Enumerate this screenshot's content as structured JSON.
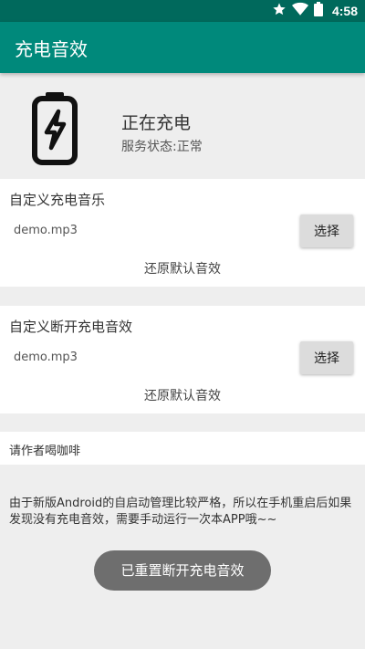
{
  "status_bar": {
    "time": "4:58",
    "icons": [
      "star-icon",
      "wifi-icon",
      "battery-icon"
    ]
  },
  "app_bar": {
    "title": "充电音效"
  },
  "charging_status": {
    "icon": "charging-battery-icon",
    "title": "正在充电",
    "service_status": "服务状态:正常"
  },
  "charge_sound": {
    "title": "自定义充电音乐",
    "file": "demo.mp3",
    "select_label": "选择",
    "restore_label": "还原默认音效"
  },
  "disconnect_sound": {
    "title": "自定义断开充电音效",
    "file": "demo.mp3",
    "select_label": "选择",
    "restore_label": "还原默认音效"
  },
  "coffee": {
    "label": "请作者喝咖啡"
  },
  "notice": {
    "text": "由于新版Android的自启动管理比较严格，所以在手机重启后如果发现没有充电音效，需要手动运行一次本APP哦~~"
  },
  "toast": {
    "text": "已重置断开充电音效"
  },
  "colors": {
    "status_bar": "#00695c",
    "app_bar": "#00897b",
    "background": "#eeeeee",
    "card": "#ffffff",
    "toast": "#6e6e6e"
  }
}
